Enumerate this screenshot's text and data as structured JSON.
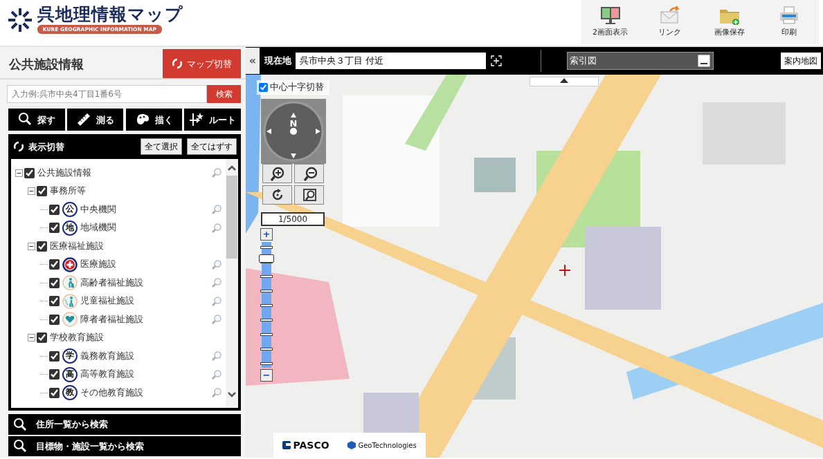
{
  "header": {
    "logo_title": "呉地理情報マップ",
    "logo_subtitle": "KURE GEOGRAPHIC INFORMATION MAP",
    "tools": [
      {
        "label": "2画面表示",
        "kind": "dual"
      },
      {
        "label": "リンク",
        "kind": "mail"
      },
      {
        "label": "画像保存",
        "kind": "folder"
      },
      {
        "label": "印刷",
        "kind": "print"
      }
    ]
  },
  "sidebar": {
    "title": "公共施設情報",
    "switch_button": "マップ切替",
    "search": {
      "placeholder": "入力例:呉市中央4丁目1番6号",
      "button": "検索"
    },
    "tools": [
      {
        "label": "探す",
        "kind": "search"
      },
      {
        "label": "測る",
        "kind": "ruler"
      },
      {
        "label": "描く",
        "kind": "palette"
      },
      {
        "label": "ルート",
        "kind": "route"
      }
    ],
    "layers": {
      "title": "表示切替",
      "select_all": "全て選択",
      "deselect_all": "全てはずす",
      "tree": [
        {
          "label": "公共施設情報",
          "checked": true,
          "expanded": true,
          "locatable": true,
          "children": [
            {
              "label": "事務所等",
              "checked": true,
              "expanded": true,
              "locatable": false,
              "children": [
                {
                  "label": "中央機関",
                  "checked": true,
                  "locatable": true,
                  "kind": "glyph",
                  "glyph": "公"
                },
                {
                  "label": "地域機関",
                  "checked": true,
                  "locatable": true,
                  "kind": "glyph",
                  "glyph": "地"
                }
              ]
            },
            {
              "label": "医療福祉施設",
              "checked": true,
              "expanded": true,
              "locatable": false,
              "children": [
                {
                  "label": "医療施設",
                  "checked": true,
                  "locatable": true,
                  "kind": "medical"
                },
                {
                  "label": "高齢者福祉施設",
                  "checked": true,
                  "locatable": true,
                  "kind": "elderly"
                },
                {
                  "label": "児童福祉施設",
                  "checked": true,
                  "locatable": true,
                  "kind": "child"
                },
                {
                  "label": "障者者福祉施設",
                  "checked": true,
                  "locatable": true,
                  "kind": "heart"
                }
              ]
            },
            {
              "label": "学校教育施設",
              "checked": true,
              "expanded": true,
              "locatable": false,
              "children": [
                {
                  "label": "義務教育施設",
                  "checked": true,
                  "locatable": true,
                  "kind": "glyph",
                  "glyph": "学"
                },
                {
                  "label": "高等教育施設",
                  "checked": true,
                  "locatable": true,
                  "kind": "glyph",
                  "glyph": "高"
                },
                {
                  "label": "その他教育施設",
                  "checked": true,
                  "locatable": true,
                  "kind": "glyph",
                  "glyph": "教"
                }
              ]
            }
          ]
        }
      ]
    },
    "bottom_links": [
      "住所一覧から検索",
      "目標物・施設一覧から検索"
    ]
  },
  "map": {
    "collapse_button": "«",
    "location_label": "現在地",
    "location_value": "呉市中央３丁目 付近",
    "index_map": {
      "title": "索引図"
    },
    "guide_button": "案内地図",
    "center_cross": {
      "label": "中心十字切替",
      "checked": true
    },
    "compass_label": "N",
    "scale": "1/5000",
    "zoom": {
      "plus": "+",
      "minus": "−",
      "level": 0.9
    },
    "attribution": [
      "PASCO",
      "GeoTechnologies"
    ]
  }
}
